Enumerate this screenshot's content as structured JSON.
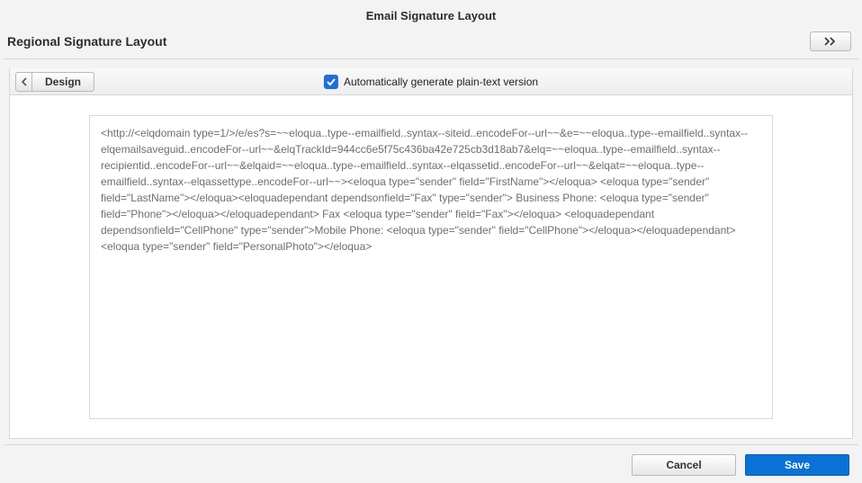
{
  "header": {
    "title": "Email Signature Layout"
  },
  "subheader": {
    "title": "Regional Signature Layout"
  },
  "toolbar": {
    "design_label": "Design",
    "autogen_label": "Automatically generate plain-text version",
    "autogen_checked": true
  },
  "editor": {
    "source_text": "<http://<elqdomain type=1/>/e/es?s=~~eloqua..type--emailfield..syntax--siteid..encodeFor--url~~&e=~~eloqua..type--emailfield..syntax--elqemailsaveguid..encodeFor--url~~&elqTrackId=944cc6e5f75c436ba42e725cb3d18ab7&elq=~~eloqua..type--emailfield..syntax--recipientid..encodeFor--url~~&elqaid=~~eloqua..type--emailfield..syntax--elqassetid..encodeFor--url~~&elqat=~~eloqua..type--emailfield..syntax--elqassettype..encodeFor--url~~><eloqua type=\"sender\" field=\"FirstName\"></eloqua>\n<eloqua type=\"sender\" field=\"LastName\"></eloqua><eloquadependant dependsonfield=\"Fax\" type=\"sender\">\nBusiness Phone: <eloqua type=\"sender\" field=\"Phone\"></eloqua></eloquadependant>\nFax <eloqua type=\"sender\" field=\"Fax\"></eloqua>\n<eloquadependant dependsonfield=\"CellPhone\" type=\"sender\">Mobile Phone: <eloqua type=\"sender\" field=\"CellPhone\"></eloqua></eloquadependant>\n<eloqua type=\"sender\" field=\"PersonalPhoto\"></eloqua>"
  },
  "footer": {
    "cancel_label": "Cancel",
    "save_label": "Save"
  }
}
